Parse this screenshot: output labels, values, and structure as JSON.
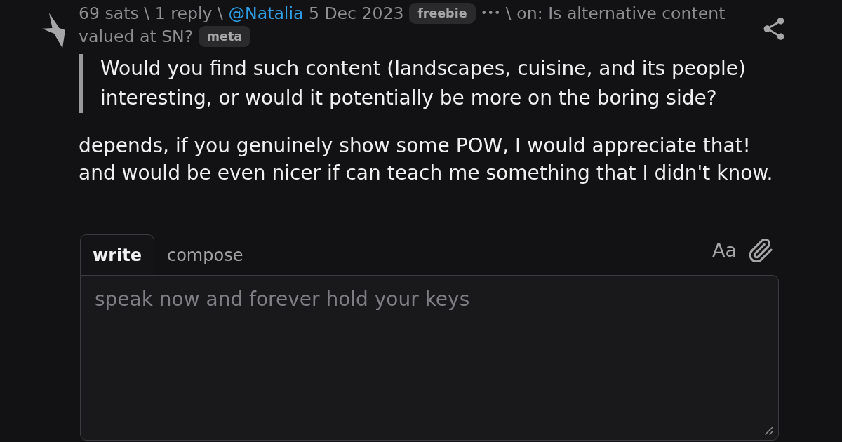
{
  "item": {
    "meta": [
      {
        "kind": "sats",
        "text": "69 sats"
      },
      {
        "kind": "separator",
        "text": "\\"
      },
      {
        "kind": "replies",
        "text": "1 reply"
      },
      {
        "kind": "separator",
        "text": "\\"
      },
      {
        "kind": "user",
        "text": "@Natalia"
      },
      {
        "kind": "date",
        "text": "5 Dec 2023"
      },
      {
        "kind": "badge",
        "text": "freebie"
      },
      {
        "kind": "menu",
        "text": "•••"
      },
      {
        "kind": "separator",
        "text": "\\"
      },
      {
        "kind": "parent",
        "text": "on: Is alternative content valued at SN?"
      },
      {
        "kind": "badge",
        "text": "meta"
      }
    ],
    "quote": "Would you find such content (landscapes, cuisine, and its people) interesting, or would it potentially be more on the boring side?",
    "body": "depends, if you genuinely show some POW, I would appreciate that!\nand would be even nicer if can teach me something that I didn't know."
  },
  "reply": {
    "tabs": [
      {
        "label": "write",
        "selected": true
      },
      {
        "label": "compose",
        "selected": false
      }
    ],
    "format_toggle": "Aa",
    "placeholder": "speak now and forever hold your keys"
  }
}
